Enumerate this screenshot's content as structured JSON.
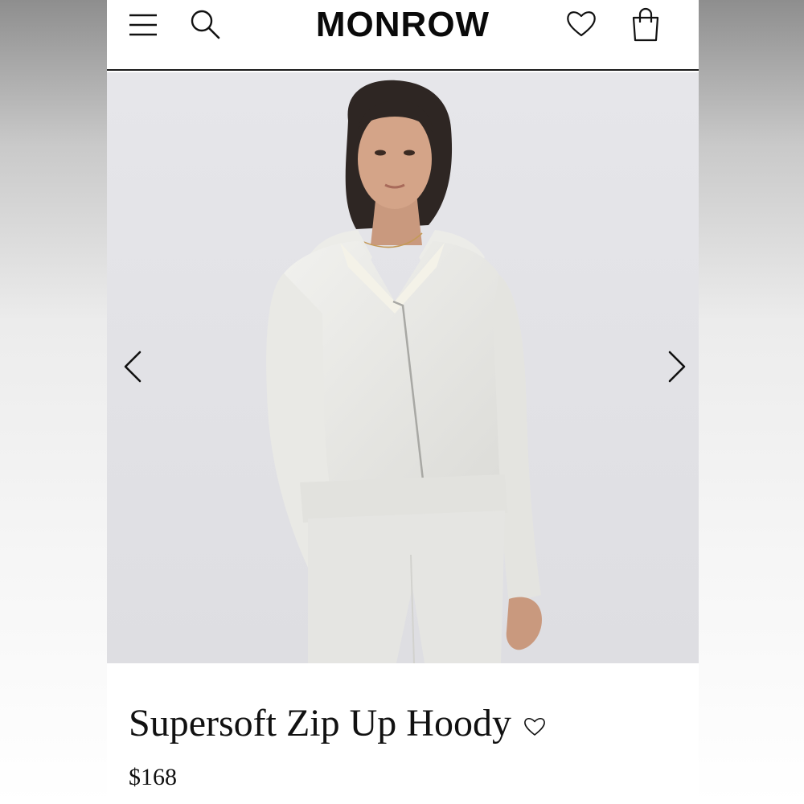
{
  "header": {
    "brand": "MONROW",
    "icons": [
      "menu-icon",
      "search-icon",
      "heart-icon",
      "shopping-bag-icon"
    ]
  },
  "gallery": {
    "image_subject": "model wearing light heather grey zip up hoodie and matching pants",
    "prev_icon": "chevron-left-icon",
    "next_icon": "chevron-right-icon"
  },
  "product": {
    "title": "Supersoft Zip Up Hoody",
    "wishlist_icon": "heart-outline-icon",
    "price": "$168"
  },
  "colors": {
    "text": "#111111",
    "photo_background": "#e3e3e7",
    "garment": "#ececea"
  }
}
